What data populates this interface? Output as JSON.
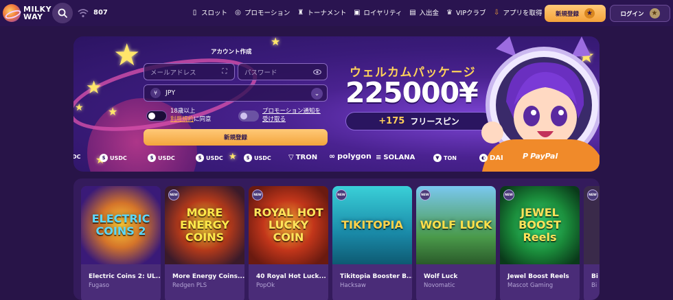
{
  "header": {
    "logo": "MILKY WAY",
    "online_count": "807",
    "nav": [
      "スロット",
      "プロモーション",
      "トーナメント",
      "ロイヤリティ",
      "入出金",
      "VIPクラブ",
      "アプリを取得"
    ],
    "nav_icons": [
      "slots-icon",
      "promo-icon",
      "tournament-icon",
      "loyalty-icon",
      "wallet-icon",
      "vip-icon",
      "download-icon"
    ],
    "signup_label": "新規登録",
    "login_label": "ログイン"
  },
  "banner": {
    "form_title": "アカウント作成",
    "email_placeholder": "メールアドレス",
    "password_placeholder": "パスワード",
    "currency_symbol": "¥",
    "currency": "JPY",
    "age_line1": "18歳以上",
    "age_terms": "利用規約",
    "age_suffix": "に同意",
    "promo_line1": "プロモーション通知を",
    "promo_line2": "受け取る",
    "signup_cta": "新規登録",
    "welcome": "ウェルカムパッケージ",
    "amount": "225000¥",
    "free_spins_count": "+175",
    "free_spins_label": "フリースピン"
  },
  "payments": [
    "DC",
    "USDC",
    "USDC",
    "USDC",
    "USDC",
    "TRON",
    "polygon",
    "SOLANA",
    "TON",
    "DAI",
    "PayPal"
  ],
  "games": [
    {
      "art": "ELECTRIC COINS 2",
      "name": "Electric Coins 2: UL...",
      "provider": "Fugaso",
      "badge": ""
    },
    {
      "art": "MORE ENERGY COINS",
      "name": "More Energy Coins...",
      "provider": "Redgen PLS",
      "badge": "NEW"
    },
    {
      "art": "ROYAL HOT LUCKY COIN",
      "name": "40 Royal Hot Luck...",
      "provider": "PopOk",
      "badge": "NEW"
    },
    {
      "art": "TIKITOPIA",
      "name": "Tikitopia Booster B...",
      "provider": "Hacksaw",
      "badge": "NEW"
    },
    {
      "art": "WOLF LUCK",
      "name": "Wolf Luck",
      "provider": "Novomatic",
      "badge": "NEW"
    },
    {
      "art": "JEWEL BOOST Reels",
      "name": "Jewel Boost Reels",
      "provider": "Mascot Gaming",
      "badge": "NEW"
    },
    {
      "art": "",
      "name": "Bi",
      "provider": "Bi",
      "badge": "NEW"
    }
  ],
  "colors": {
    "background": "#281448",
    "accent": "#f5a23a",
    "link": "#ffb34a",
    "welcome": "#ffd25a"
  }
}
